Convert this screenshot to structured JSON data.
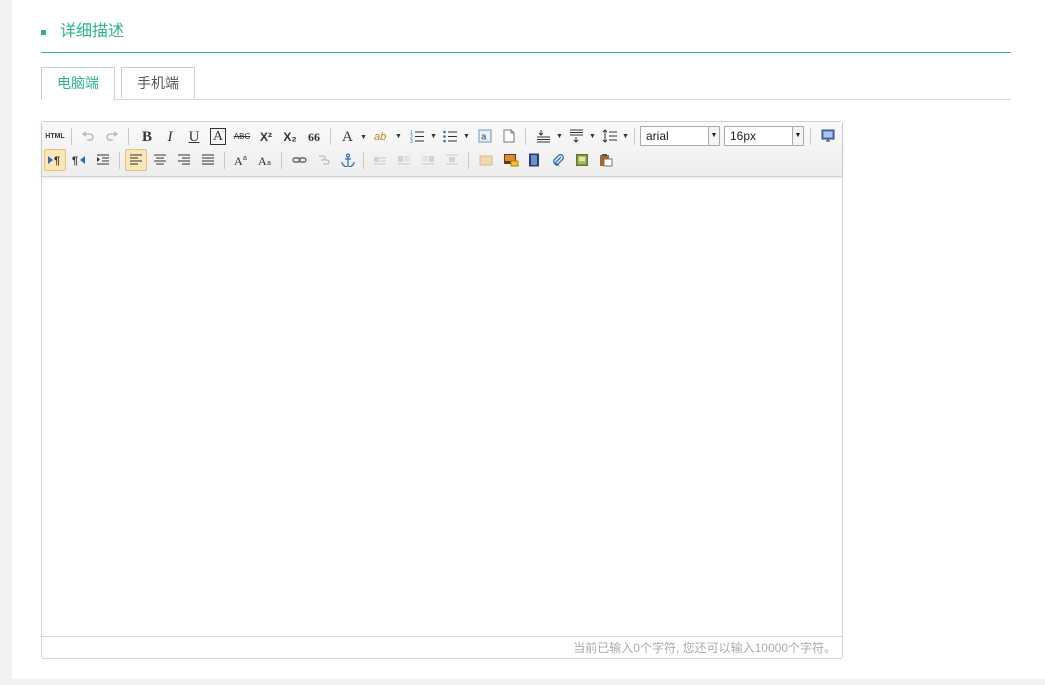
{
  "section": {
    "title": "详细描述",
    "accent_color": "#2bb38a"
  },
  "tabs": [
    {
      "label": "电脑端",
      "active": true
    },
    {
      "label": "手机端",
      "active": false
    }
  ],
  "toolbar": {
    "html_label": "HTML",
    "bold": "B",
    "italic": "I",
    "underline": "U",
    "border": "A",
    "strike": "ABC",
    "superscript": "X²",
    "subscript": "X₂",
    "quote": "66",
    "forecolor": "A",
    "backcolor": "ab",
    "font_family": "arial",
    "font_size": "16px",
    "icons": {
      "undo": "undo-icon",
      "redo": "redo-icon",
      "ordered_list": "ordered-list-icon",
      "unordered_list": "unordered-list-icon",
      "select_all": "select-all-icon",
      "clear_doc": "clear-doc-icon",
      "paragraph_spacing_top": "row-spacing-top-icon",
      "paragraph_spacing_bottom": "row-spacing-bottom-icon",
      "line_height": "line-height-icon",
      "preview": "preview-icon",
      "ltr": "direction-ltr-icon",
      "rtl": "direction-rtl-icon",
      "indent": "indent-icon",
      "align_left": "align-left-icon",
      "align_center": "align-center-icon",
      "align_right": "align-right-icon",
      "align_justify": "align-justify-icon",
      "uppercase": "uppercase-icon",
      "lowercase": "lowercase-icon",
      "link": "link-icon",
      "unlink": "unlink-icon",
      "anchor": "anchor-icon",
      "image_none": "image-none-icon",
      "image_left": "image-left-icon",
      "image_right": "image-right-icon",
      "image_center": "image-center-icon",
      "simple_upload": "simple-upload-icon",
      "insert_image": "insert-image-icon",
      "insert_video": "insert-video-icon",
      "attachment": "attachment-icon",
      "template": "template-icon",
      "paste": "paste-icon"
    }
  },
  "statusbar": {
    "text": "当前已输入0个字符, 您还可以输入10000个字符。"
  }
}
